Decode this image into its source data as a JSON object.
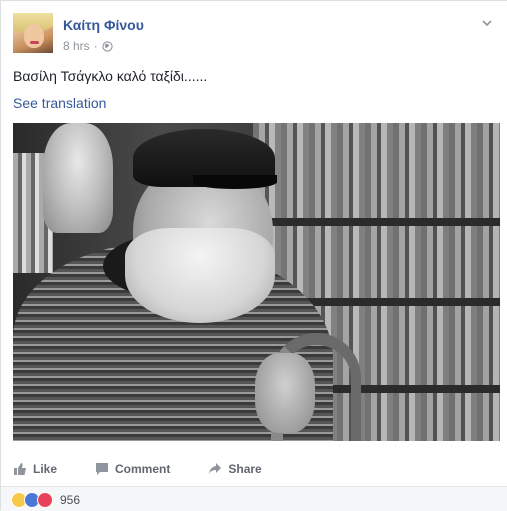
{
  "post": {
    "author": "Καίτη Φίνου",
    "time": "8 hrs",
    "separator": "·",
    "text": "Βασίλη Τσάγκλο καλό ταξίδι......",
    "see_translation": "See translation"
  },
  "actions": {
    "like": "Like",
    "comment": "Comment",
    "share": "Share"
  },
  "reactions": {
    "types": [
      "sad",
      "like",
      "love"
    ],
    "count": "956"
  },
  "colors": {
    "author_link": "#365899",
    "action_text": "#616770",
    "meta_text": "#90949c"
  },
  "icons": [
    "privacy-globe-icon",
    "options-chevron-icon",
    "like-icon",
    "comment-icon",
    "share-icon"
  ]
}
